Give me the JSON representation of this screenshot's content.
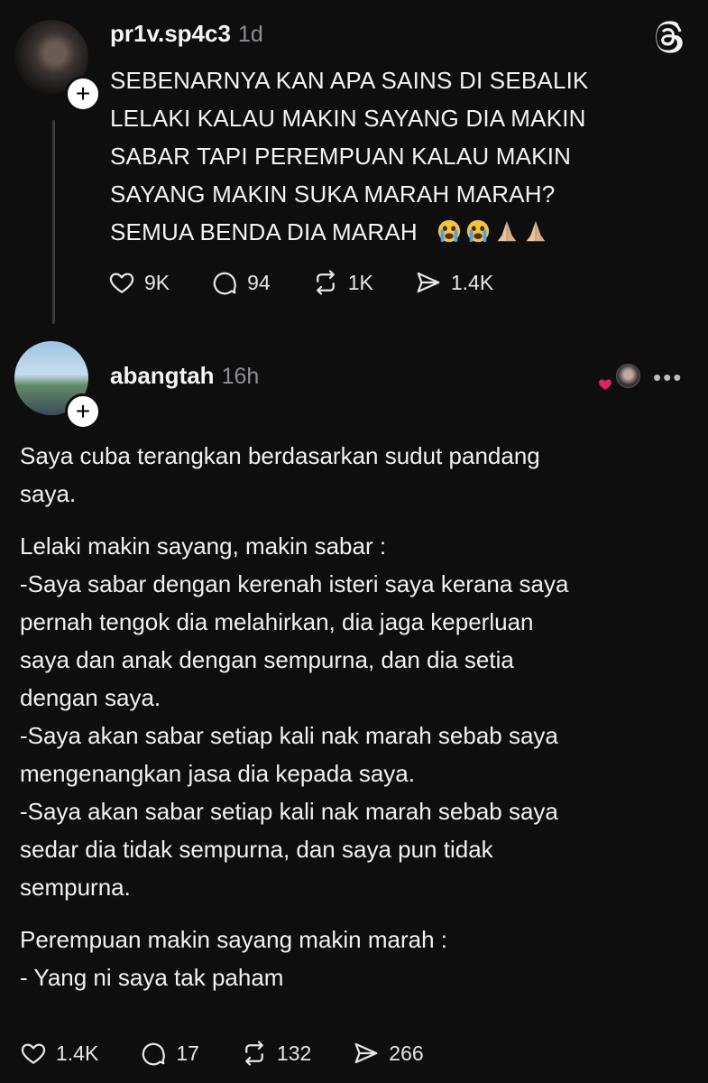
{
  "post1": {
    "username": "pr1v.sp4c3",
    "time": "1d",
    "text_lines": [
      "SEBENARNYA KAN APA SAINS DI SEBALIK",
      "LELAKI KALAU MAKIN SAYANG DIA MAKIN",
      "SABAR TAPI PEREMPUAN KALAU MAKIN",
      "SAYANG MAKIN SUKA MARAH MARAH?",
      "SEMUA BENDA DIA MARAH"
    ],
    "emojis": [
      "crying-face",
      "crying-face",
      "folded-hands",
      "folded-hands"
    ],
    "likes": "9K",
    "comments": "94",
    "reposts": "1K",
    "shares": "1.4K"
  },
  "post2": {
    "username": "abangtah",
    "time": "16h",
    "paragraphs": [
      [
        "Saya cuba terangkan berdasarkan sudut pandang",
        "saya."
      ],
      [
        "Lelaki makin sayang, makin sabar :",
        "-Saya sabar dengan kerenah isteri saya kerana saya",
        "pernah tengok dia melahirkan, dia jaga keperluan",
        "saya dan anak dengan sempurna, dan dia setia",
        "dengan saya.",
        "-Saya akan sabar setiap kali nak marah sebab saya",
        "mengenangkan jasa dia kepada saya.",
        "-Saya akan sabar setiap kali nak marah sebab saya",
        "sedar dia tidak sempurna, dan saya pun tidak",
        "sempurna."
      ],
      [
        "Perempuan makin sayang makin marah :",
        "- Yang ni saya tak paham"
      ]
    ],
    "likes": "1.4K",
    "comments": "17",
    "reposts": "132",
    "shares": "266"
  },
  "ui": {
    "more_label": "•••",
    "follow_label": "+"
  },
  "colors": {
    "background": "#0e0e0f",
    "text": "#f3f3f3",
    "muted": "#8e8e93",
    "heart": "#e0245e"
  }
}
